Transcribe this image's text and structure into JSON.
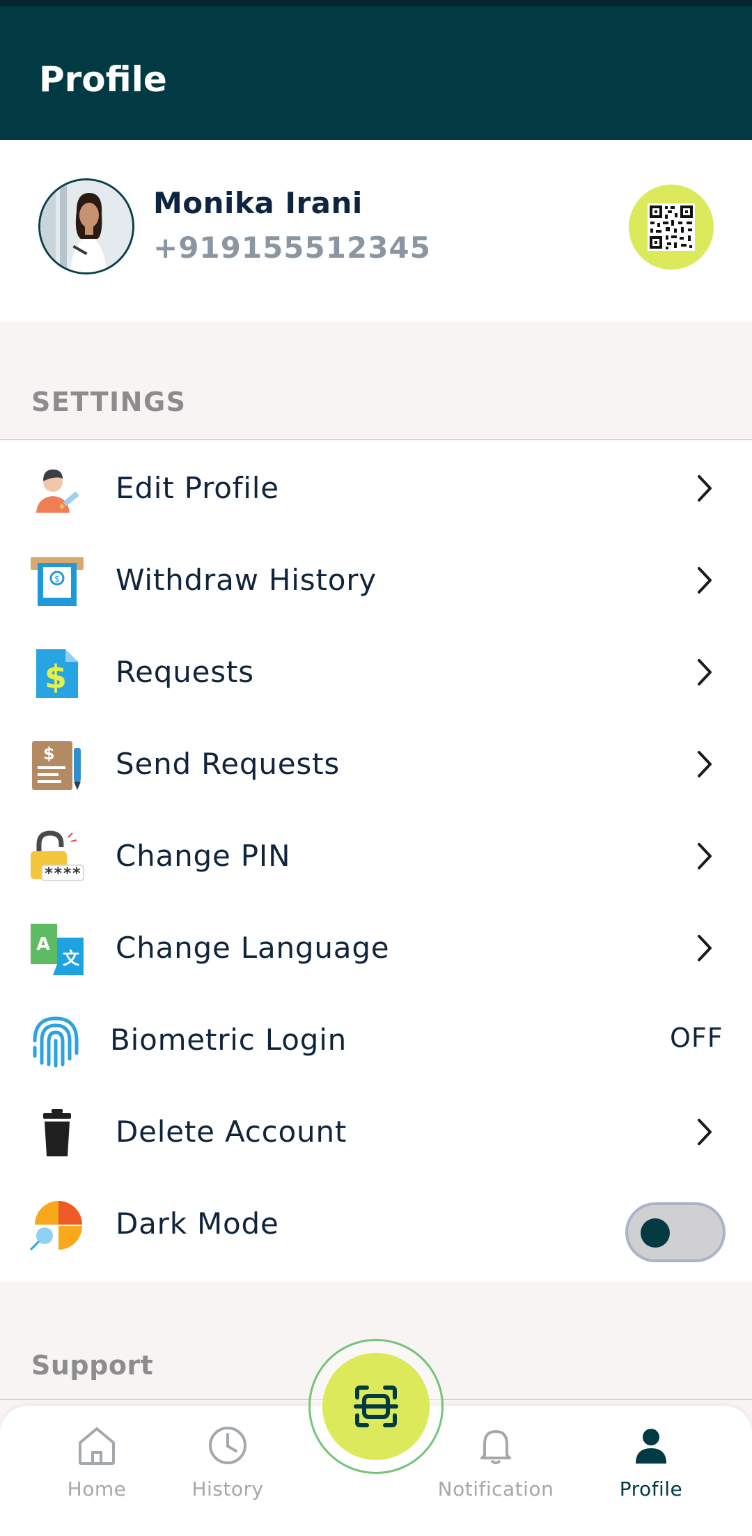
{
  "app": {
    "title": "Profile"
  },
  "profile": {
    "name": "Monika Irani",
    "phone": "+919155512345"
  },
  "sections": {
    "settings": "SETTINGS",
    "support": "Support"
  },
  "menu": {
    "items": [
      {
        "label": "Edit Profile",
        "icon": "edit-profile-icon"
      },
      {
        "label": "Withdraw History",
        "icon": "withdraw-history-icon"
      },
      {
        "label": "Requests",
        "icon": "requests-icon"
      },
      {
        "label": "Send Requests",
        "icon": "send-requests-icon"
      },
      {
        "label": "Change PIN",
        "icon": "change-pin-icon",
        "pin_mask": "****"
      },
      {
        "label": "Change Language",
        "icon": "change-language-icon",
        "glyph_a": "A",
        "glyph_b": "文"
      },
      {
        "label": "Biometric Login",
        "icon": "fingerprint-icon",
        "state": "OFF"
      },
      {
        "label": "Delete Account",
        "icon": "trash-icon"
      },
      {
        "label": "Dark Mode",
        "icon": "dark-mode-icon",
        "toggle_on": false
      }
    ]
  },
  "bottom_nav": {
    "items": [
      {
        "label": "Home",
        "icon": "home-icon"
      },
      {
        "label": "History",
        "icon": "clock-icon"
      },
      {
        "label": "Notification",
        "icon": "bell-icon"
      },
      {
        "label": "Profile",
        "icon": "person-icon",
        "active": true
      }
    ],
    "center_action": "scan-qr-icon"
  },
  "colors": {
    "header_bg": "#023a43",
    "accent": "#dbe95a",
    "text_primary": "#10243b",
    "text_muted": "#8a97a3"
  }
}
